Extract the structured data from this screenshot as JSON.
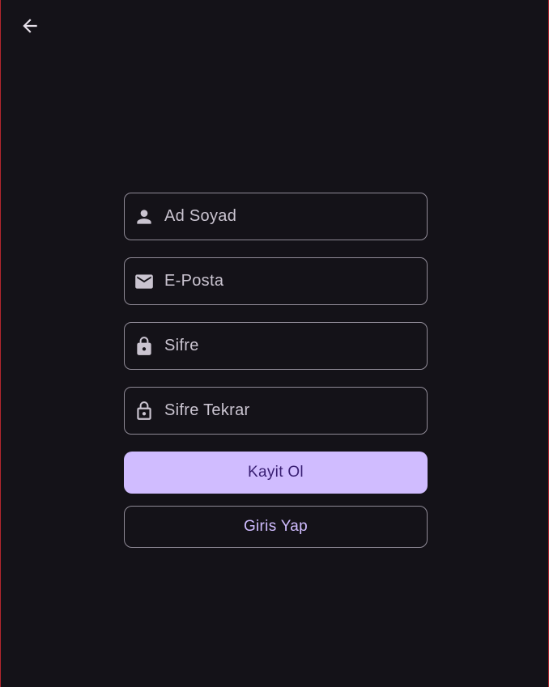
{
  "app_bar": {
    "back_icon": "arrow-back-icon"
  },
  "form": {
    "fields": [
      {
        "icon": "person-icon",
        "value": "",
        "placeholder": "Ad Soyad"
      },
      {
        "icon": "mail-icon",
        "value": "",
        "placeholder": "E-Posta"
      },
      {
        "icon": "lock-icon",
        "value": "",
        "placeholder": "Sifre"
      },
      {
        "icon": "lock-outline-icon",
        "value": "",
        "placeholder": "Sifre Tekrar"
      }
    ],
    "register_label": "Kayit Ol",
    "login_label": "Giris Yap"
  },
  "colors": {
    "background": "#141218",
    "primary": "#d0bcff",
    "on_primary": "#381e72",
    "outline": "#8f8a96",
    "text": "#cac4d0",
    "frame_border": "#b3262e"
  }
}
